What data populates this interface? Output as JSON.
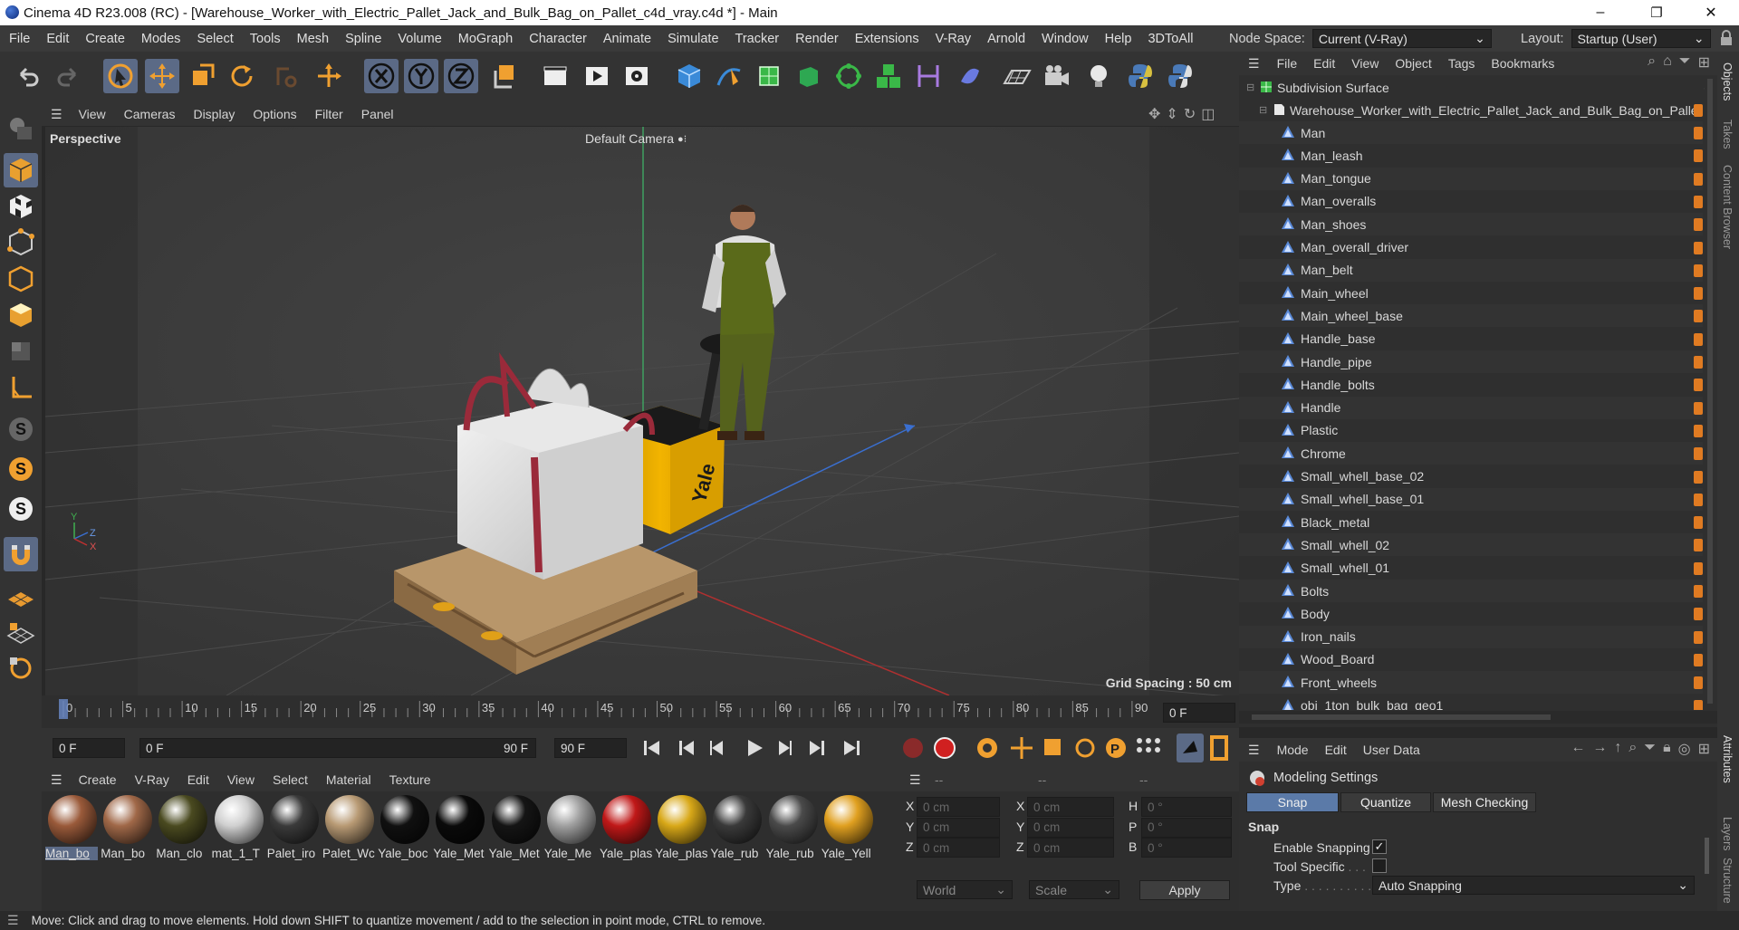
{
  "window": {
    "title": "Cinema 4D R23.008 (RC) - [Warehouse_Worker_with_Electric_Pallet_Jack_and_Bulk_Bag_on_Pallet_c4d_vray.c4d *] - Main",
    "minimize": "–",
    "maximize": "❐",
    "close": "✕"
  },
  "menubar": {
    "items": [
      "File",
      "Edit",
      "Create",
      "Modes",
      "Select",
      "Tools",
      "Mesh",
      "Spline",
      "Volume",
      "MoGraph",
      "Character",
      "Animate",
      "Simulate",
      "Tracker",
      "Render",
      "Extensions",
      "V-Ray",
      "Arnold",
      "Window",
      "Help",
      "3DToAll"
    ],
    "node_space_label": "Node Space:",
    "node_space_value": "Current (V-Ray)",
    "layout_label": "Layout:",
    "layout_value": "Startup (User)"
  },
  "viewport": {
    "menu": [
      "View",
      "Cameras",
      "Display",
      "Options",
      "Filter",
      "Panel"
    ],
    "name": "Perspective",
    "camera": "Default Camera",
    "grid_spacing": "Grid Spacing : 50 cm",
    "axis_x": "X",
    "axis_y": "Y",
    "axis_z": "Z",
    "brand_text": "Yale"
  },
  "timeline": {
    "ticks": [
      "0",
      "5",
      "10",
      "15",
      "20",
      "25",
      "30",
      "35",
      "40",
      "45",
      "50",
      "55",
      "60",
      "65",
      "70",
      "75",
      "80",
      "85",
      "90"
    ],
    "current_frame": "0 F"
  },
  "transport": {
    "start_field": "0 F",
    "current_field": "0 F",
    "end_inner": "90 F",
    "end_field": "90 F"
  },
  "material_panel": {
    "menu": [
      "Create",
      "V-Ray",
      "Edit",
      "View",
      "Select",
      "Material",
      "Texture"
    ],
    "materials": [
      {
        "name": "Man_bo",
        "color": "#9a5a3a"
      },
      {
        "name": "Man_bo",
        "color": "#a06848"
      },
      {
        "name": "Man_clo",
        "color": "#4a4a20"
      },
      {
        "name": "mat_1_T",
        "color": "#d0d0d0"
      },
      {
        "name": "Palet_iro",
        "color": "#3a3a3a"
      },
      {
        "name": "Palet_Wc",
        "color": "#b89a74"
      },
      {
        "name": "Yale_boc",
        "color": "#101010"
      },
      {
        "name": "Yale_Met",
        "color": "#0a0a0a"
      },
      {
        "name": "Yale_Met",
        "color": "#151515"
      },
      {
        "name": "Yale_Me",
        "color": "#a0a0a0"
      },
      {
        "name": "Yale_plas",
        "color": "#c01818"
      },
      {
        "name": "Yale_plas",
        "color": "#d8a818"
      },
      {
        "name": "Yale_rub",
        "color": "#3a3a3a"
      },
      {
        "name": "Yale_rub",
        "color": "#4a4a4a"
      },
      {
        "name": "Yale_Yell",
        "color": "#e0a020"
      }
    ]
  },
  "coords": {
    "headers": [
      "--",
      "--",
      "--"
    ],
    "rows": [
      {
        "a": "X",
        "av": "0 cm",
        "b": "X",
        "bv": "0 cm",
        "c": "H",
        "cv": "0 °"
      },
      {
        "a": "Y",
        "av": "0 cm",
        "b": "Y",
        "bv": "0 cm",
        "c": "P",
        "cv": "0 °"
      },
      {
        "a": "Z",
        "av": "0 cm",
        "b": "Z",
        "bv": "0 cm",
        "c": "B",
        "cv": "0 °"
      }
    ],
    "world": "World",
    "scale": "Scale",
    "apply": "Apply"
  },
  "object_manager": {
    "menu": [
      "File",
      "Edit",
      "View",
      "Object",
      "Tags",
      "Bookmarks"
    ],
    "root": "Subdivision Surface",
    "group": "Warehouse_Worker_with_Electric_Pallet_Jack_and_Bulk_Bag_on_Pallet",
    "children": [
      "Man",
      "Man_leash",
      "Man_tongue",
      "Man_overalls",
      "Man_shoes",
      "Man_overall_driver",
      "Man_belt",
      "Main_wheel",
      "Main_wheel_base",
      "Handle_base",
      "Handle_pipe",
      "Handle_bolts",
      "Handle",
      "Plastic",
      "Chrome",
      "Small_whell_base_02",
      "Small_whell_base_01",
      "Black_metal",
      "Small_whell_02",
      "Small_whell_01",
      "Bolts",
      "Body",
      "Iron_nails",
      "Wood_Board",
      "Front_wheels",
      "obj_1ton_bulk_bag_geo1"
    ]
  },
  "attributes": {
    "menu": [
      "Mode",
      "Edit",
      "User Data"
    ],
    "title": "Modeling Settings",
    "tabs": [
      "Snap",
      "Quantize",
      "Mesh Checking"
    ],
    "section": "Snap",
    "enable_snapping": "Enable Snapping",
    "tool_specific": "Tool Specific",
    "type_label": "Type",
    "type_value": "Auto Snapping"
  },
  "right_tabs": [
    "Objects",
    "Takes",
    "Content Browser",
    "Attributes",
    "Layers",
    "Structure"
  ],
  "status": "Move: Click and drag to move elements. Hold down SHIFT to quantize movement / add to the selection in point mode, CTRL to remove."
}
